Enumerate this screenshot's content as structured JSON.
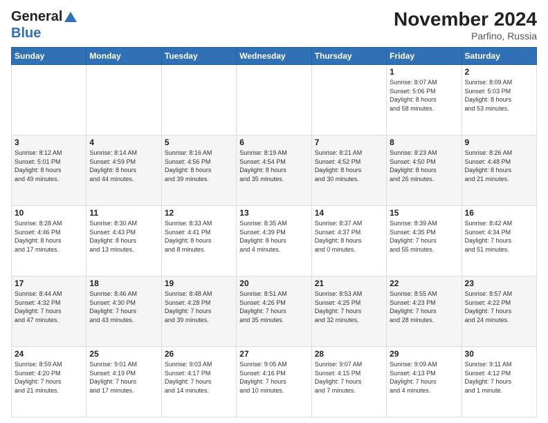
{
  "header": {
    "logo_general": "General",
    "logo_blue": "Blue",
    "title": "November 2024",
    "subtitle": "Parfino, Russia"
  },
  "weekdays": [
    "Sunday",
    "Monday",
    "Tuesday",
    "Wednesday",
    "Thursday",
    "Friday",
    "Saturday"
  ],
  "weeks": [
    [
      {
        "day": "",
        "info": ""
      },
      {
        "day": "",
        "info": ""
      },
      {
        "day": "",
        "info": ""
      },
      {
        "day": "",
        "info": ""
      },
      {
        "day": "",
        "info": ""
      },
      {
        "day": "1",
        "info": "Sunrise: 8:07 AM\nSunset: 5:06 PM\nDaylight: 8 hours\nand 58 minutes."
      },
      {
        "day": "2",
        "info": "Sunrise: 8:09 AM\nSunset: 5:03 PM\nDaylight: 8 hours\nand 53 minutes."
      }
    ],
    [
      {
        "day": "3",
        "info": "Sunrise: 8:12 AM\nSunset: 5:01 PM\nDaylight: 8 hours\nand 49 minutes."
      },
      {
        "day": "4",
        "info": "Sunrise: 8:14 AM\nSunset: 4:59 PM\nDaylight: 8 hours\nand 44 minutes."
      },
      {
        "day": "5",
        "info": "Sunrise: 8:16 AM\nSunset: 4:56 PM\nDaylight: 8 hours\nand 39 minutes."
      },
      {
        "day": "6",
        "info": "Sunrise: 8:19 AM\nSunset: 4:54 PM\nDaylight: 8 hours\nand 35 minutes."
      },
      {
        "day": "7",
        "info": "Sunrise: 8:21 AM\nSunset: 4:52 PM\nDaylight: 8 hours\nand 30 minutes."
      },
      {
        "day": "8",
        "info": "Sunrise: 8:23 AM\nSunset: 4:50 PM\nDaylight: 8 hours\nand 26 minutes."
      },
      {
        "day": "9",
        "info": "Sunrise: 8:26 AM\nSunset: 4:48 PM\nDaylight: 8 hours\nand 21 minutes."
      }
    ],
    [
      {
        "day": "10",
        "info": "Sunrise: 8:28 AM\nSunset: 4:46 PM\nDaylight: 8 hours\nand 17 minutes."
      },
      {
        "day": "11",
        "info": "Sunrise: 8:30 AM\nSunset: 4:43 PM\nDaylight: 8 hours\nand 13 minutes."
      },
      {
        "day": "12",
        "info": "Sunrise: 8:33 AM\nSunset: 4:41 PM\nDaylight: 8 hours\nand 8 minutes."
      },
      {
        "day": "13",
        "info": "Sunrise: 8:35 AM\nSunset: 4:39 PM\nDaylight: 8 hours\nand 4 minutes."
      },
      {
        "day": "14",
        "info": "Sunrise: 8:37 AM\nSunset: 4:37 PM\nDaylight: 8 hours\nand 0 minutes."
      },
      {
        "day": "15",
        "info": "Sunrise: 8:39 AM\nSunset: 4:35 PM\nDaylight: 7 hours\nand 55 minutes."
      },
      {
        "day": "16",
        "info": "Sunrise: 8:42 AM\nSunset: 4:34 PM\nDaylight: 7 hours\nand 51 minutes."
      }
    ],
    [
      {
        "day": "17",
        "info": "Sunrise: 8:44 AM\nSunset: 4:32 PM\nDaylight: 7 hours\nand 47 minutes."
      },
      {
        "day": "18",
        "info": "Sunrise: 8:46 AM\nSunset: 4:30 PM\nDaylight: 7 hours\nand 43 minutes."
      },
      {
        "day": "19",
        "info": "Sunrise: 8:48 AM\nSunset: 4:28 PM\nDaylight: 7 hours\nand 39 minutes."
      },
      {
        "day": "20",
        "info": "Sunrise: 8:51 AM\nSunset: 4:26 PM\nDaylight: 7 hours\nand 35 minutes."
      },
      {
        "day": "21",
        "info": "Sunrise: 8:53 AM\nSunset: 4:25 PM\nDaylight: 7 hours\nand 32 minutes."
      },
      {
        "day": "22",
        "info": "Sunrise: 8:55 AM\nSunset: 4:23 PM\nDaylight: 7 hours\nand 28 minutes."
      },
      {
        "day": "23",
        "info": "Sunrise: 8:57 AM\nSunset: 4:22 PM\nDaylight: 7 hours\nand 24 minutes."
      }
    ],
    [
      {
        "day": "24",
        "info": "Sunrise: 8:59 AM\nSunset: 4:20 PM\nDaylight: 7 hours\nand 21 minutes."
      },
      {
        "day": "25",
        "info": "Sunrise: 9:01 AM\nSunset: 4:19 PM\nDaylight: 7 hours\nand 17 minutes."
      },
      {
        "day": "26",
        "info": "Sunrise: 9:03 AM\nSunset: 4:17 PM\nDaylight: 7 hours\nand 14 minutes."
      },
      {
        "day": "27",
        "info": "Sunrise: 9:05 AM\nSunset: 4:16 PM\nDaylight: 7 hours\nand 10 minutes."
      },
      {
        "day": "28",
        "info": "Sunrise: 9:07 AM\nSunset: 4:15 PM\nDaylight: 7 hours\nand 7 minutes."
      },
      {
        "day": "29",
        "info": "Sunrise: 9:09 AM\nSunset: 4:13 PM\nDaylight: 7 hours\nand 4 minutes."
      },
      {
        "day": "30",
        "info": "Sunrise: 9:11 AM\nSunset: 4:12 PM\nDaylight: 7 hours\nand 1 minute."
      }
    ]
  ]
}
